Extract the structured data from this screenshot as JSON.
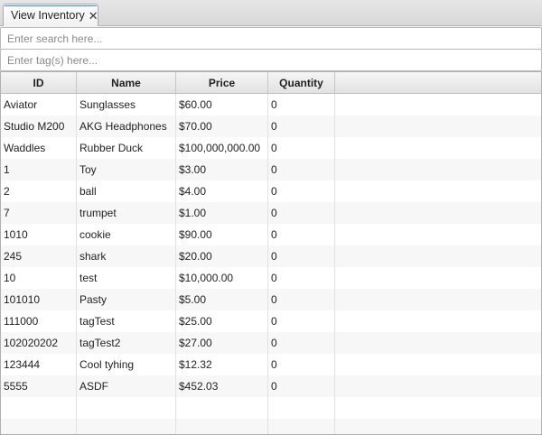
{
  "tabs": [
    {
      "label": "View Inventory",
      "close_glyph": "✕"
    }
  ],
  "search": {
    "placeholder": "Enter search here...",
    "value": ""
  },
  "tags": {
    "placeholder": "Enter tag(s) here...",
    "value": ""
  },
  "table": {
    "columns": [
      "ID",
      "Name",
      "Price",
      "Quantity"
    ],
    "rows": [
      {
        "id": "Aviator",
        "name": "Sunglasses",
        "price": "$60.00",
        "quantity": "0"
      },
      {
        "id": "Studio M200",
        "name": "AKG Headphones",
        "price": "$70.00",
        "quantity": "0"
      },
      {
        "id": "Waddles",
        "name": "Rubber Duck",
        "price": "$100,000,000.00",
        "quantity": "0"
      },
      {
        "id": "1",
        "name": "Toy",
        "price": "$3.00",
        "quantity": "0"
      },
      {
        "id": "2",
        "name": "ball",
        "price": "$4.00",
        "quantity": "0"
      },
      {
        "id": "7",
        "name": "trumpet",
        "price": "$1.00",
        "quantity": "0"
      },
      {
        "id": "1010",
        "name": "cookie",
        "price": "$90.00",
        "quantity": "0"
      },
      {
        "id": "245",
        "name": "shark",
        "price": "$20.00",
        "quantity": "0"
      },
      {
        "id": "10",
        "name": "test",
        "price": "$10,000.00",
        "quantity": "0"
      },
      {
        "id": "101010",
        "name": "Pasty",
        "price": "$5.00",
        "quantity": "0"
      },
      {
        "id": "111000",
        "name": "tagTest",
        "price": "$25.00",
        "quantity": "0"
      },
      {
        "id": "102020202",
        "name": "tagTest2",
        "price": "$27.00",
        "quantity": "0"
      },
      {
        "id": "123444",
        "name": "Cool tyhing",
        "price": "$12.32",
        "quantity": "0"
      },
      {
        "id": "5555",
        "name": "ASDF",
        "price": "$452.03",
        "quantity": "0"
      }
    ]
  }
}
